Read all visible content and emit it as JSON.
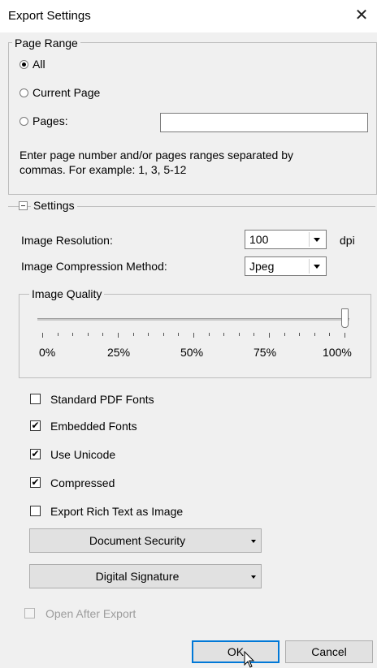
{
  "window": {
    "title": "Export Settings",
    "close_glyph": "✕"
  },
  "page_range": {
    "legend": "Page Range",
    "options": [
      {
        "label": "All",
        "checked": true
      },
      {
        "label": "Current Page",
        "checked": false
      },
      {
        "label": "Pages:",
        "checked": false
      }
    ],
    "pages_value": "",
    "hint_line1": "Enter page number and/or pages ranges separated by",
    "hint_line2": "commas. For example: 1, 3, 5-12"
  },
  "settings": {
    "legend": "Settings",
    "image_resolution_label": "Image Resolution:",
    "image_resolution_value": "100",
    "image_resolution_unit": "dpi",
    "compression_label": "Image Compression Method:",
    "compression_value": "Jpeg",
    "image_quality": {
      "legend": "Image Quality",
      "value_percent": 100,
      "tick_labels": [
        "0%",
        "25%",
        "50%",
        "75%",
        "100%"
      ]
    },
    "checkboxes": [
      {
        "label": "Standard PDF Fonts",
        "checked": false
      },
      {
        "label": "Embedded Fonts",
        "checked": true
      },
      {
        "label": "Use Unicode",
        "checked": true
      },
      {
        "label": "Compressed",
        "checked": true
      },
      {
        "label": "Export Rich Text as Image",
        "checked": false
      }
    ],
    "document_security_label": "Document Security",
    "digital_signature_label": "Digital Signature"
  },
  "open_after_export": {
    "label": "Open After Export",
    "checked": false,
    "enabled": false
  },
  "buttons": {
    "ok": "OK",
    "cancel": "Cancel"
  },
  "icons": {
    "check_glyph": "✔",
    "collapse": "minus-box-icon",
    "dropdown": "chevron-down-icon",
    "cursor": "mouse-pointer-icon"
  }
}
